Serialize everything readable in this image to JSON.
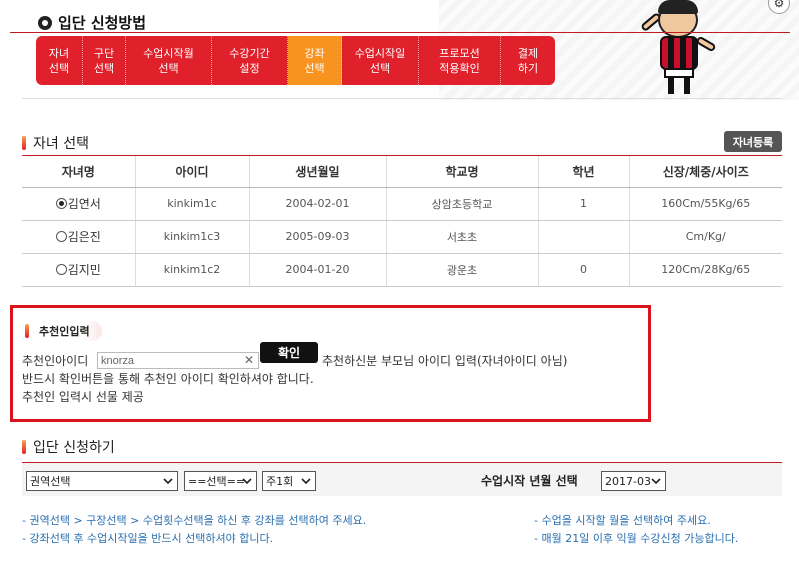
{
  "header": {
    "title": "입단 신청방법",
    "steps": [
      {
        "line1": "자녀",
        "line2": "선택",
        "color": "#e0202a"
      },
      {
        "line1": "구단",
        "line2": "선택",
        "color": "#e0202a"
      },
      {
        "line1": "수업시작월",
        "line2": "선택",
        "color": "#e0202a"
      },
      {
        "line1": "수강기간",
        "line2": "설정",
        "color": "#e0202a"
      },
      {
        "line1": "강좌",
        "line2": "선택",
        "color": "#f7931e"
      },
      {
        "line1": "수업시작일",
        "line2": "선택",
        "color": "#e0202a"
      },
      {
        "line1": "프로모션",
        "line2": "적용확인",
        "color": "#e0202a"
      },
      {
        "line1": "결제",
        "line2": "하기",
        "color": "#e0202a"
      }
    ],
    "mascot_icon": "soccer-player-mascot",
    "mascot_shirt_text": "future"
  },
  "children_section": {
    "title": "자녀 선택",
    "register_button": "자녀등록",
    "columns": [
      "자녀명",
      "아이디",
      "생년월일",
      "학교명",
      "학년",
      "신장/체중/사이즈"
    ],
    "rows": [
      {
        "name": "김연서",
        "id": "kinkim1c",
        "birth": "2004-02-01",
        "school": "상암초등학교",
        "grade": "1",
        "size": "160Cm/55Kg/65",
        "selected": true
      },
      {
        "name": "김은진",
        "id": "kinkim1c3",
        "birth": "2005-09-03",
        "school": "서초초",
        "grade": "",
        "size": "Cm/Kg/",
        "selected": false
      },
      {
        "name": "김지민",
        "id": "kinkim1c2",
        "birth": "2004-01-20",
        "school": "광운초",
        "grade": "0",
        "size": "120Cm/28Kg/65",
        "selected": false
      }
    ]
  },
  "recommender": {
    "title": "추천인입력",
    "input_label": "추천인아이디",
    "input_value": "knorza",
    "confirm_button": "확인",
    "hint": "추천하신분 부모님 아이디 입력(자녀아이디 아님)",
    "notice1": "반드시 확인버튼을 통해 추천인 아이디 확인하셔야 합니다.",
    "notice2": "추천인 입력시 선물 제공"
  },
  "application": {
    "title": "입단 신청하기",
    "region_select": "권역선택",
    "option_select": "==선택==",
    "frequency_select": "주1회",
    "month_label": "수업시작 년월 선택",
    "month_select": "2017-03",
    "notes_left": [
      "- 권역선택 > 구장선택 > 수업횟수선택을 하신 후 강좌를 선택하여 주세요.",
      "- 강좌선택 후 수업시작일을 반드시 선택하셔야 합니다."
    ],
    "notes_right": [
      "- 수업을 시작할 월을 선택하여 주세요.",
      "- 매월 21일 이후 익월 수강신청 가능합니다."
    ]
  },
  "colors": {
    "accent_red": "#e0202a",
    "accent_orange": "#f7931e",
    "note_blue": "#2a6fb0"
  }
}
